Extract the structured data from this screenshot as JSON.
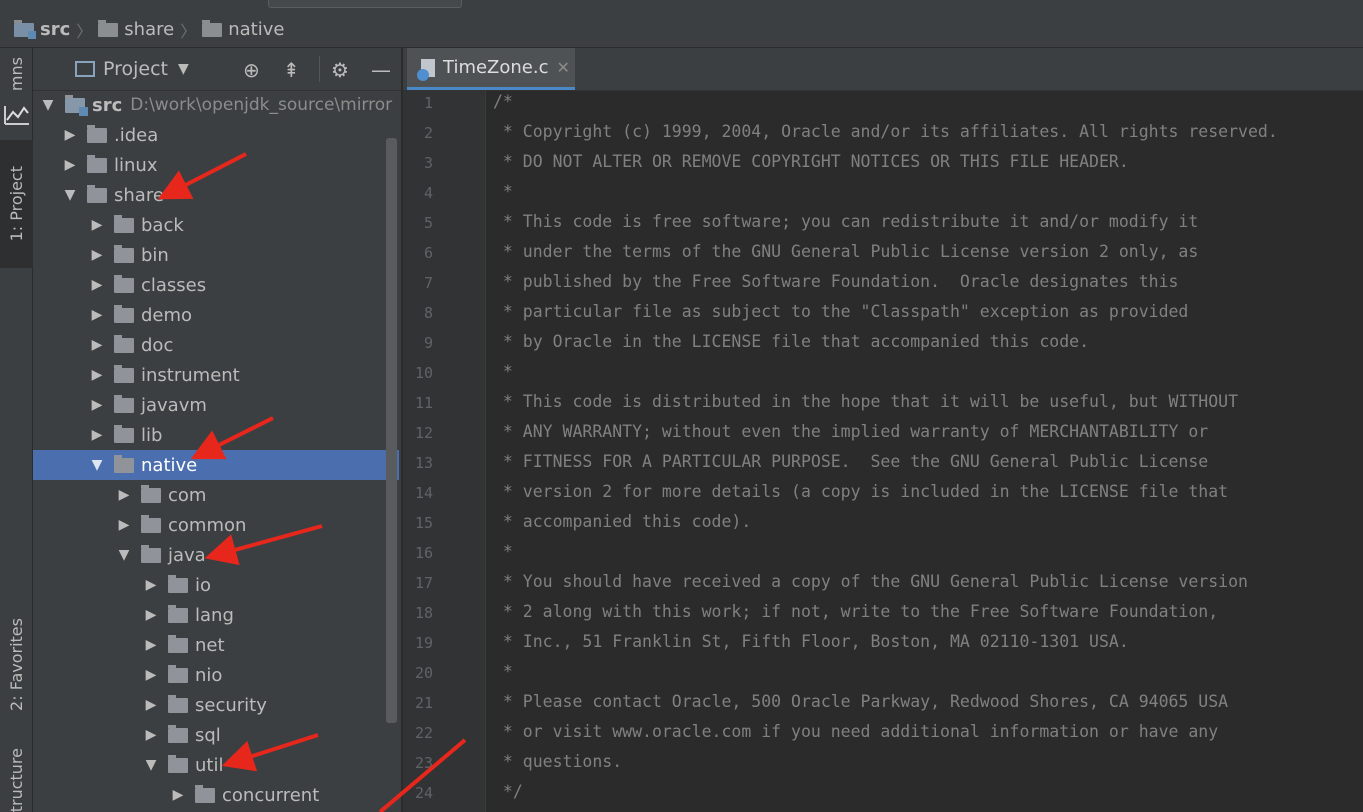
{
  "breadcrumb": {
    "items": [
      "src",
      "share",
      "native"
    ]
  },
  "sidebar": {
    "tabs": [
      "mns",
      "1: Project",
      "2: Favorites",
      "tructure"
    ]
  },
  "project_panel": {
    "title": "Project",
    "root_label": "src",
    "root_path": "D:\\work\\openjdk_source\\mirror",
    "tree": [
      {
        "label": "src",
        "depth": 0,
        "expanded": true,
        "root": true
      },
      {
        "label": ".idea",
        "depth": 1,
        "expanded": false
      },
      {
        "label": "linux",
        "depth": 1,
        "expanded": false
      },
      {
        "label": "share",
        "depth": 1,
        "expanded": true
      },
      {
        "label": "back",
        "depth": 2,
        "expanded": false
      },
      {
        "label": "bin",
        "depth": 2,
        "expanded": false
      },
      {
        "label": "classes",
        "depth": 2,
        "expanded": false
      },
      {
        "label": "demo",
        "depth": 2,
        "expanded": false
      },
      {
        "label": "doc",
        "depth": 2,
        "expanded": false
      },
      {
        "label": "instrument",
        "depth": 2,
        "expanded": false
      },
      {
        "label": "javavm",
        "depth": 2,
        "expanded": false
      },
      {
        "label": "lib",
        "depth": 2,
        "expanded": false
      },
      {
        "label": "native",
        "depth": 2,
        "expanded": true,
        "selected": true
      },
      {
        "label": "com",
        "depth": 3,
        "expanded": false
      },
      {
        "label": "common",
        "depth": 3,
        "expanded": false
      },
      {
        "label": "java",
        "depth": 3,
        "expanded": true
      },
      {
        "label": "io",
        "depth": 4,
        "expanded": false
      },
      {
        "label": "lang",
        "depth": 4,
        "expanded": false
      },
      {
        "label": "net",
        "depth": 4,
        "expanded": false
      },
      {
        "label": "nio",
        "depth": 4,
        "expanded": false
      },
      {
        "label": "security",
        "depth": 4,
        "expanded": false
      },
      {
        "label": "sql",
        "depth": 4,
        "expanded": false
      },
      {
        "label": "util",
        "depth": 4,
        "expanded": true
      },
      {
        "label": "concurrent",
        "depth": 5,
        "expanded": false
      }
    ]
  },
  "editor": {
    "tab_label": "TimeZone.c",
    "lines": [
      "/*",
      " * Copyright (c) 1999, 2004, Oracle and/or its affiliates. All rights reserved.",
      " * DO NOT ALTER OR REMOVE COPYRIGHT NOTICES OR THIS FILE HEADER.",
      " *",
      " * This code is free software; you can redistribute it and/or modify it",
      " * under the terms of the GNU General Public License version 2 only, as",
      " * published by the Free Software Foundation.  Oracle designates this",
      " * particular file as subject to the \"Classpath\" exception as provided",
      " * by Oracle in the LICENSE file that accompanied this code.",
      " *",
      " * This code is distributed in the hope that it will be useful, but WITHOUT",
      " * ANY WARRANTY; without even the implied warranty of MERCHANTABILITY or",
      " * FITNESS FOR A PARTICULAR PURPOSE.  See the GNU General Public License",
      " * version 2 for more details (a copy is included in the LICENSE file that",
      " * accompanied this code).",
      " *",
      " * You should have received a copy of the GNU General Public License version",
      " * 2 along with this work; if not, write to the Free Software Foundation,",
      " * Inc., 51 Franklin St, Fifth Floor, Boston, MA 02110-1301 USA.",
      " *",
      " * Please contact Oracle, 500 Oracle Parkway, Redwood Shores, CA 94065 USA",
      " * or visit www.oracle.com if you need additional information or have any",
      " * questions.",
      " */"
    ]
  },
  "colors": {
    "selection": "#4b6eaf",
    "annotation_arrow": "#e8271c",
    "comment": "#808080"
  }
}
